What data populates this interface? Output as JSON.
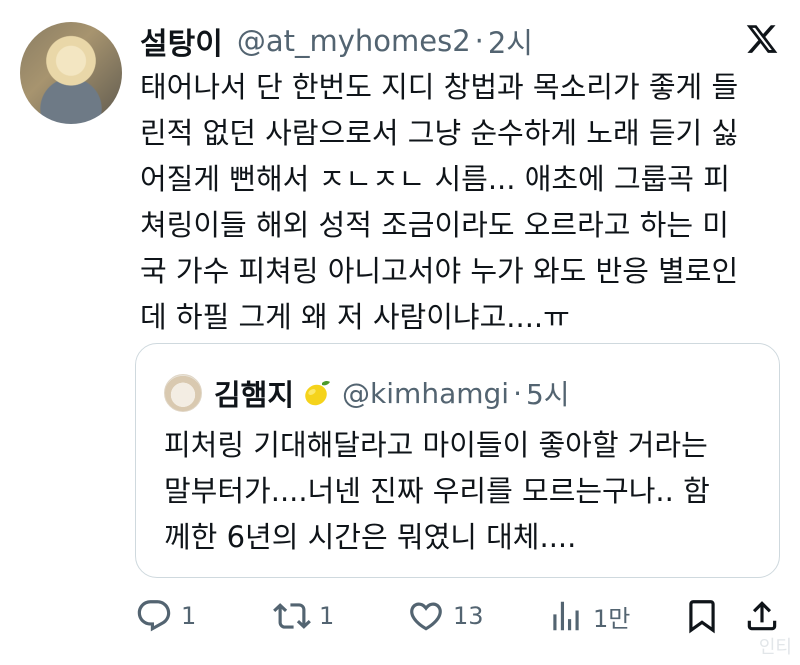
{
  "tweet": {
    "display_name": "설탕이",
    "handle": "@at_myhomes2",
    "separator": "·",
    "time": "2시",
    "text_lines": [
      "태어나서 단 한번도 지디 창법과 목소리가 좋게 들",
      "린적 없던 사람으로서 그냥 순수하게 노래 듣기 싫",
      "어질게 뻔해서 ㅈㄴㅈㄴ 시름... 애초에 그룹곡 피",
      "쳐링이들 해외 성적 조금이라도 오르라고 하는 미",
      "국 가수 피쳐링 아니고서야 누가 와도 반응 별로인",
      "데 하필 그게 왜 저 사람이냐고....ㅠ"
    ]
  },
  "quote": {
    "display_name": "김햄지",
    "emoji_icon": "lemon-emoji",
    "handle": "@kimhamgi",
    "separator": "·",
    "time": "5시",
    "text_lines": [
      "피처링 기대해달라고 마이들이 좋아할 거라는",
      "말부터가....너넨 진짜 우리를 모르는구나.. 함",
      "께한 6년의 시간은 뭐였니 대체...."
    ]
  },
  "actions": {
    "reply_count": "1",
    "retweet_count": "1",
    "like_count": "13",
    "views_count": "1만"
  },
  "watermark": "인티",
  "colors": {
    "text": "#0f1419",
    "secondary": "#536471",
    "border": "#cfd9de"
  }
}
